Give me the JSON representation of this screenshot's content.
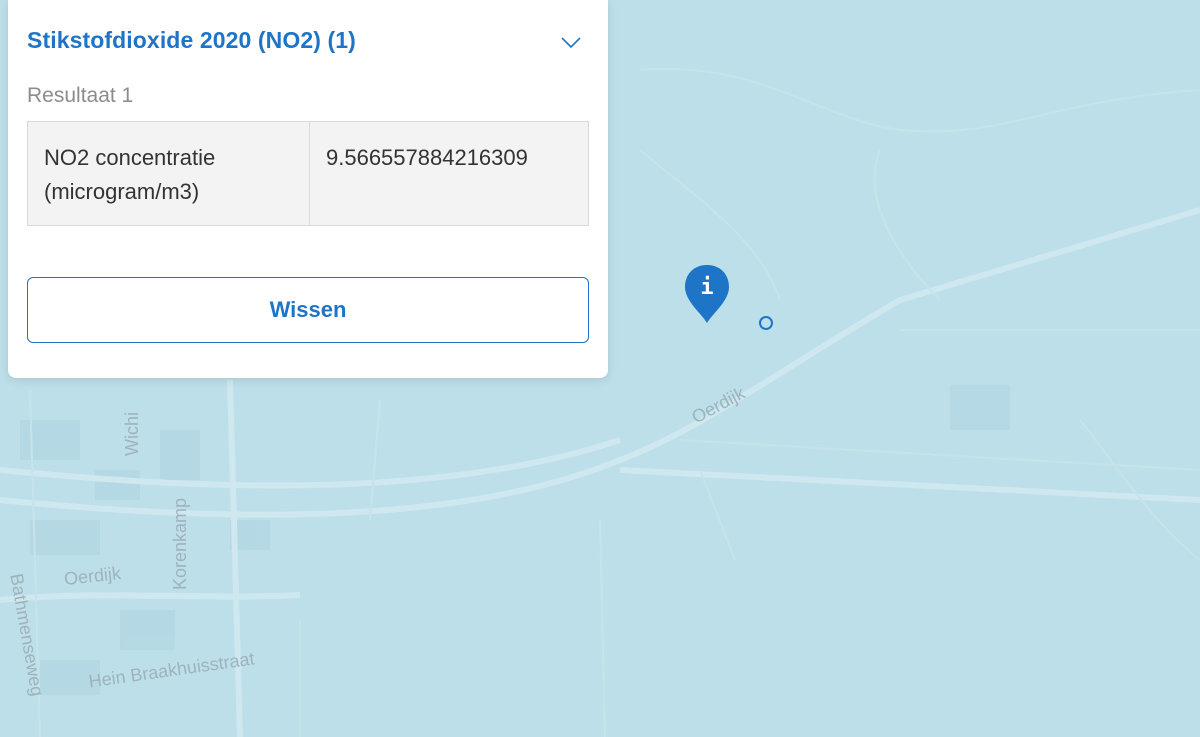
{
  "panel": {
    "title": "Stikstofdioxide 2020 (NO2) (1)",
    "result_label": "Resultaat 1",
    "table": [
      {
        "key": "NO2 concentratie (microgram/m3)",
        "value": "9.566557884216309"
      }
    ],
    "clear_button": "Wissen"
  },
  "map": {
    "marker_glyph": "i",
    "streets": [
      {
        "name": "Oerdijk"
      },
      {
        "name": "Oerdijk"
      },
      {
        "name": "Korenkamp"
      },
      {
        "name": "Wichi"
      },
      {
        "name": "Bathmenseweg"
      },
      {
        "name": "Hein Braakhuisstraat"
      }
    ]
  },
  "colors": {
    "accent": "#1e75c7",
    "map_water": "#bcdfe9",
    "panel_bg": "#ffffff",
    "table_bg": "#f3f3f3"
  },
  "icons": {
    "collapse": "chevron-down-icon",
    "info_marker": "info-marker-icon",
    "click_location": "circle-icon"
  }
}
